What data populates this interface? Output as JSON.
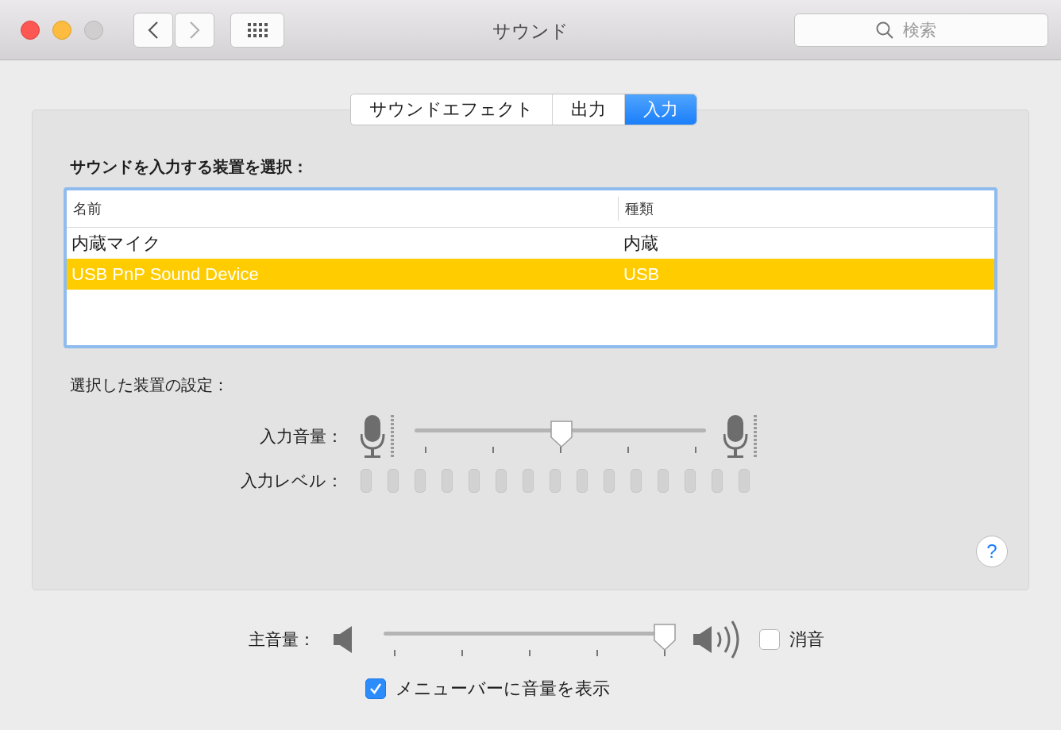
{
  "window": {
    "title": "サウンド"
  },
  "toolbar": {
    "search": {
      "placeholder": "検索"
    }
  },
  "tabs": [
    {
      "label": "サウンドエフェクト",
      "selected": false
    },
    {
      "label": "出力",
      "selected": false
    },
    {
      "label": "入力",
      "selected": true
    }
  ],
  "input": {
    "heading": "サウンドを入力する装置を選択：",
    "table": {
      "columns": [
        "名前",
        "種類"
      ],
      "rows": [
        {
          "cells": [
            "内蔵マイク",
            "内蔵"
          ],
          "selected": false
        },
        {
          "cells": [
            "USB PnP Sound Device",
            "USB"
          ],
          "selected": true
        }
      ]
    },
    "settings_heading": "選択した装置の設定：",
    "input_volume": {
      "label": "入力音量：",
      "level": 0.5
    },
    "input_level": {
      "label": "入力レベル："
    },
    "help": "?"
  },
  "output_volume": {
    "label": "主音量：",
    "level": 1
  },
  "mute": {
    "label": "消音",
    "checked": false
  },
  "show_in_menu_bar": {
    "label": "メニューバーに音量を表示",
    "checked": true
  }
}
